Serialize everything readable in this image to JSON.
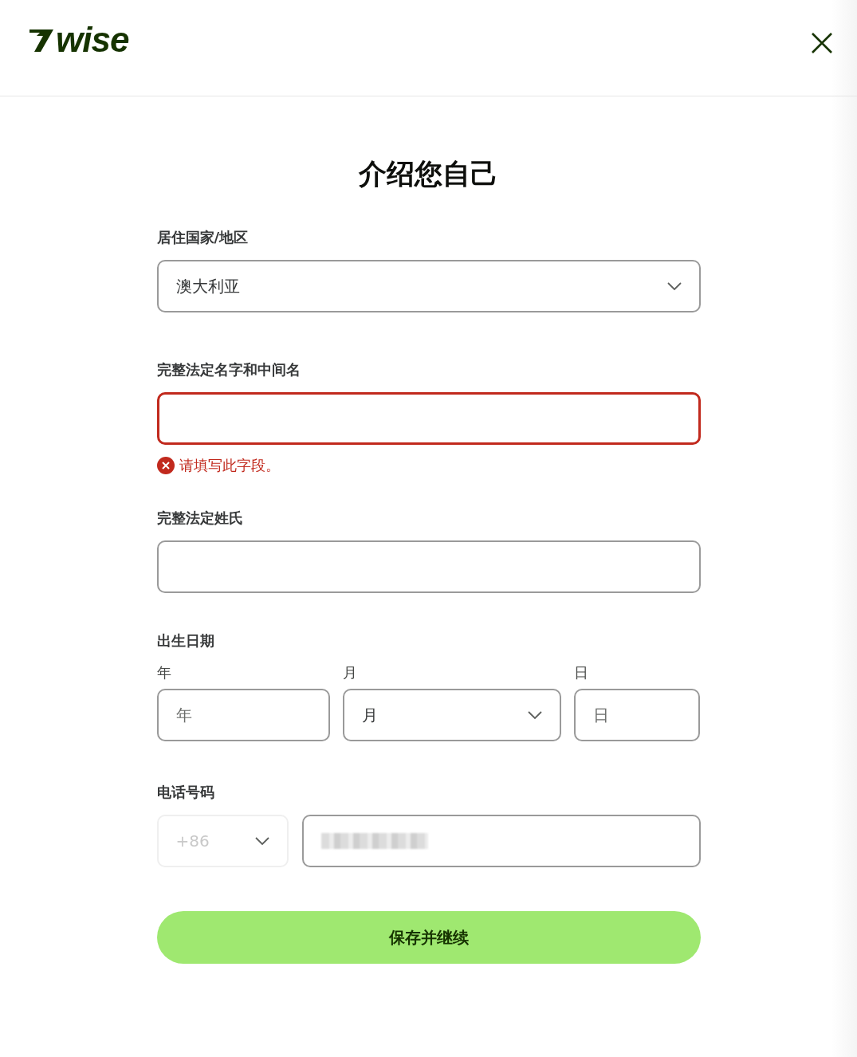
{
  "header": {
    "logo": "wise"
  },
  "title": "介绍您自己",
  "country": {
    "label": "居住国家/地区",
    "value": "澳大利亚"
  },
  "first_name": {
    "label": "完整法定名字和中间名",
    "error": true,
    "error_text": "请填写此字段。"
  },
  "last_name": {
    "label": "完整法定姓氏",
    "error": false
  },
  "dob": {
    "label": "出生日期",
    "parts": [
      {
        "kind": "input",
        "label": "年",
        "placeholder": "年"
      },
      {
        "kind": "select",
        "label": "月",
        "placeholder": "月"
      },
      {
        "kind": "input",
        "label": "日",
        "placeholder": "日"
      }
    ]
  },
  "phone": {
    "label": "电话号码",
    "code": "+86",
    "code_disabled": true
  },
  "submit": "保存并继续"
}
